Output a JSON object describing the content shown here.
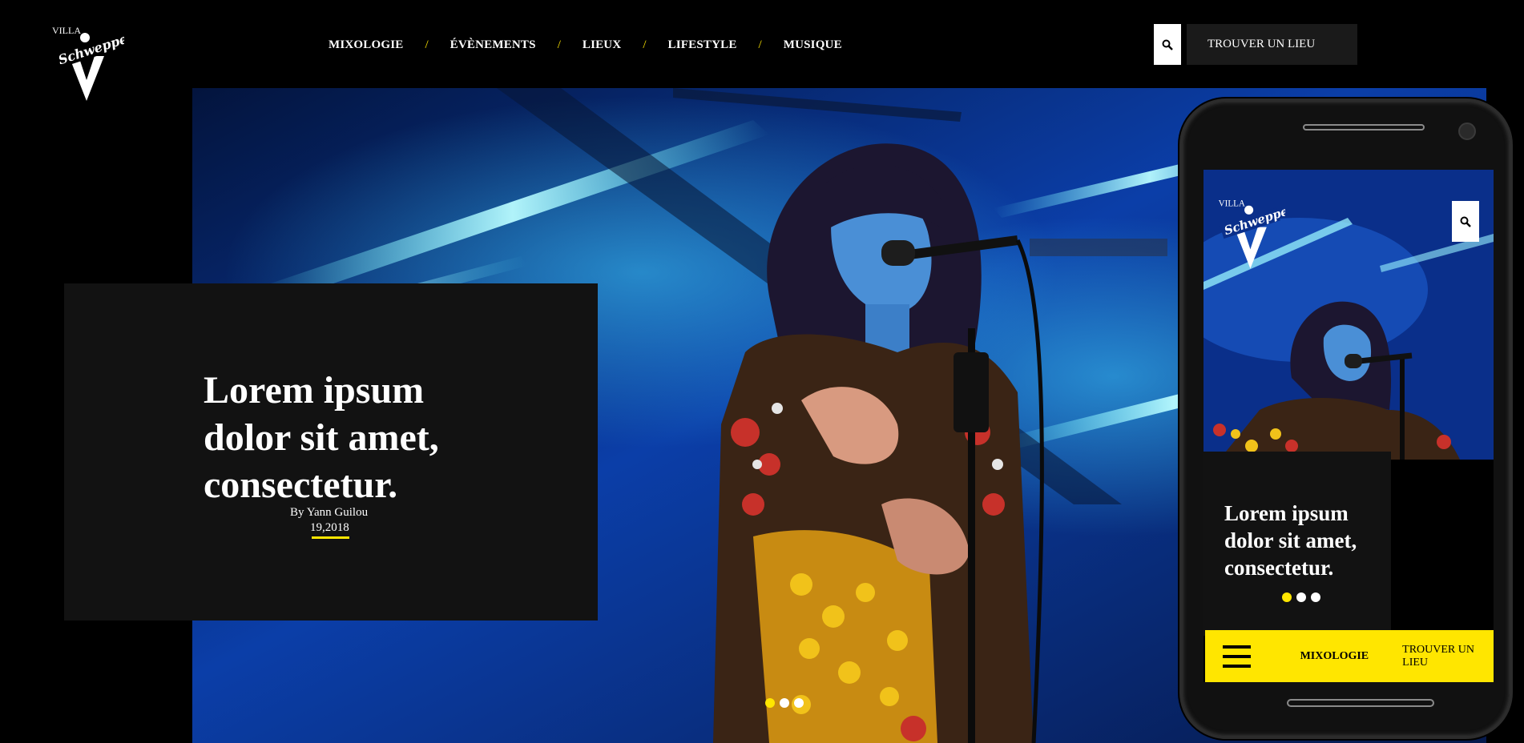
{
  "brand": {
    "logo_text_top": "VILLA",
    "logo_text_main": "Schweppes",
    "logo_letter": "V"
  },
  "nav": {
    "items": [
      "MIXOLOGIE",
      "ÉVÈNEMENTS",
      "LIEUX",
      "LIFESTYLE",
      "MUSIQUE"
    ],
    "separator": "/"
  },
  "header": {
    "search_icon": "search-icon",
    "find_place_label": "TROUVER UN LIEU"
  },
  "hero": {
    "title": "Lorem ipsum dolor sit amet, consectetur.",
    "author": "By Yann Guilou",
    "date": "19,2018",
    "slides": 3,
    "active_slide": 1
  },
  "mobile": {
    "title": "Lorem ipsum dolor sit amet, consectetur.",
    "search_icon": "search-icon",
    "menu_icon": "hamburger-menu-icon",
    "nav_label": "MIXOLOGIE",
    "find_place_label": "TROUVER UN LIEU",
    "slides": 3,
    "active_slide": 1
  },
  "colors": {
    "accent": "#ffe600",
    "background": "#000000",
    "card": "#121212",
    "stage_blue": "#0a3a9a"
  }
}
